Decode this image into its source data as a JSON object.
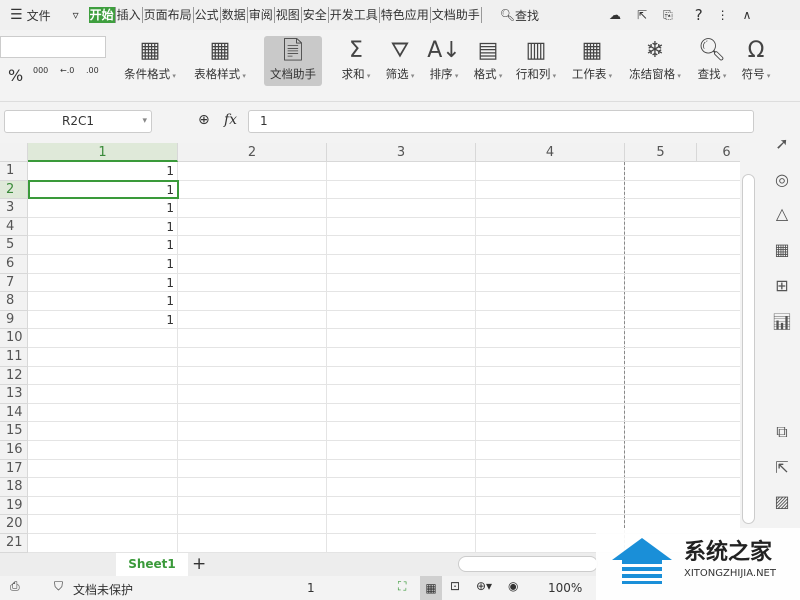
{
  "menu": {
    "file": "文件",
    "tabs": [
      "开始",
      "插入",
      "页面布局",
      "公式",
      "数据",
      "审阅",
      "视图",
      "安全",
      "开发工具",
      "特色应用",
      "文档助手"
    ],
    "search": "查找"
  },
  "ribbon": {
    "buttons": [
      "条件格式",
      "表格样式",
      "文档助手",
      "求和",
      "筛选",
      "排序",
      "格式",
      "行和列",
      "工作表",
      "冻结窗格",
      "查找",
      "符号"
    ],
    "percent": "%",
    "thousand": "000",
    "inc_dec": "←.0",
    "dec_dec": ".00"
  },
  "formula": {
    "namebox": "R2C1",
    "fx": "fx",
    "value": "1"
  },
  "grid": {
    "columns": [
      "1",
      "2",
      "3",
      "4",
      "5",
      "6"
    ],
    "rows": [
      "1",
      "2",
      "3",
      "4",
      "5",
      "6",
      "7",
      "8",
      "9",
      "10",
      "11",
      "12",
      "13",
      "14",
      "15",
      "16",
      "17",
      "18",
      "19",
      "20",
      "21"
    ],
    "col1_values": [
      "1",
      "1",
      "1",
      "1",
      "1",
      "1",
      "1",
      "1",
      "1"
    ]
  },
  "sheets": {
    "tabs": [
      "Sheet1"
    ],
    "add": "+"
  },
  "status": {
    "protect": "文档未保护",
    "value": "1",
    "zoom": "100%"
  },
  "watermark": {
    "title": "系统之家",
    "url": "XITONGZHIJIA.NET"
  }
}
